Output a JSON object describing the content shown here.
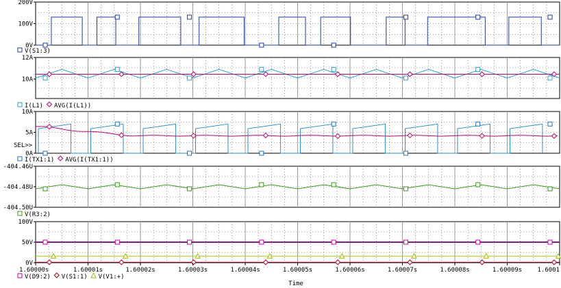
{
  "chart_data": [
    {
      "type": "line",
      "panel": 1,
      "y_ticks": [
        "200V",
        "100V",
        "0V"
      ],
      "ylim": [
        0,
        200
      ],
      "legend": [
        {
          "name": "V(S1:3)",
          "marker": "square",
          "color": "#1f3aa6"
        }
      ],
      "series": [
        {
          "name": "V(S1:3)",
          "color": "#1f3aa6",
          "kind": "pulse",
          "high": 130,
          "low": 0,
          "period_s": 1.01e-05,
          "rise_times_s": [
            1.600003,
            1.6000117,
            1.6000197,
            1.6000312,
            1.6000464,
            1.6000544,
            1.6000669,
            1.6000748,
            1.6000903
          ],
          "fall_times_s": [
            1.6000089,
            1.6000153,
            1.6000277,
            1.6000398,
            1.6000515,
            1.6000601,
            1.6000705,
            1.6000858,
            1.6000965
          ]
        }
      ]
    },
    {
      "type": "line",
      "panel": 2,
      "y_ticks": [
        "12A",
        "10A"
      ],
      "ylim": [
        8.2,
        12
      ],
      "legend": [
        {
          "name": "I(L1)",
          "marker": "square",
          "color": "#2aa0c8"
        },
        {
          "name": "AVG(I(L1))",
          "marker": "diamond",
          "color": "#c0006a"
        }
      ],
      "series": [
        {
          "name": "I(L1)",
          "color": "#2aa0c8",
          "kind": "triangle",
          "min": 10.1,
          "max": 10.9
        },
        {
          "name": "AVG(I(L1))",
          "color": "#c0006a",
          "kind": "flat",
          "value": 10.45
        }
      ]
    },
    {
      "type": "line",
      "panel": 3,
      "y_ticks": [
        "10A",
        "5A",
        "0A"
      ],
      "ylim": [
        0,
        10
      ],
      "sel_marker": "SEL>>",
      "legend": [
        {
          "name": "I(TX1:1)",
          "marker": "square",
          "color": "#1f6fc0"
        },
        {
          "name": "AVG(I(TX1:1))",
          "marker": "diamond",
          "color": "#c0006a"
        }
      ],
      "series": [
        {
          "name": "I(TX1:1)",
          "color": "#2a8fd0",
          "kind": "switched",
          "on_low": 5.9,
          "on_high": 7.0,
          "off": 0
        },
        {
          "name": "AVG(I(TX1:1))",
          "color": "#c0006a",
          "kind": "avg",
          "start": 6.4,
          "settle": 4.2
        }
      ]
    },
    {
      "type": "line",
      "panel": 4,
      "y_ticks": [
        "-404.46U",
        "-404.48U",
        "-404.50U"
      ],
      "ylim": [
        -404.5,
        -404.46
      ],
      "legend": [
        {
          "name": "V(R3:2)",
          "marker": "square",
          "color": "#3a9a1a"
        }
      ],
      "series": [
        {
          "name": "V(R3:2)",
          "color": "#3a9a1a",
          "kind": "ripple",
          "value": -404.48
        }
      ]
    },
    {
      "type": "line",
      "panel": 5,
      "y_ticks": [
        "100V",
        "50V",
        "0V"
      ],
      "ylim": [
        0,
        100
      ],
      "legend": [
        {
          "name": "V(D9:2)",
          "marker": "square",
          "color": "#c000a0"
        },
        {
          "name": "V(S1:1)",
          "marker": "diamond",
          "color": "#b00020"
        },
        {
          "name": "V(V1:+)",
          "marker": "triangle",
          "color": "#a0c000"
        }
      ],
      "series": [
        {
          "name": "V(D9:2)",
          "color": "#8a1a8a",
          "kind": "flat",
          "value": 50
        },
        {
          "name": "V(S1:1)",
          "color": "#b00020",
          "kind": "flat",
          "value": 1
        },
        {
          "name": "V(V1:+)",
          "color": "#a8d000",
          "kind": "flat",
          "value": 16
        }
      ]
    }
  ],
  "x_axis": {
    "label": "Time",
    "range_s": [
      1.6,
      1.6001
    ],
    "ticks": [
      "1.60000s",
      "1.60001s",
      "1.60002s",
      "1.60003s",
      "1.60004s",
      "1.60005s",
      "1.60006s",
      "1.60007s",
      "1.60008s",
      "1.60009s",
      "1.6001"
    ]
  }
}
